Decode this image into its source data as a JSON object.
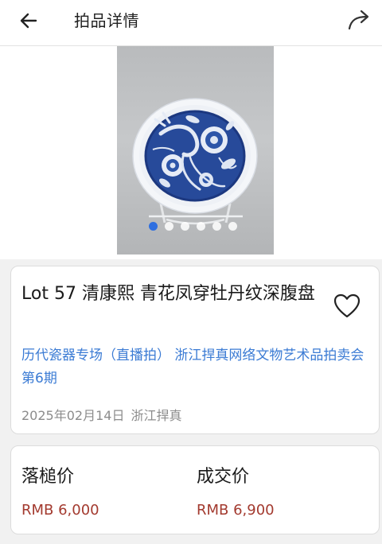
{
  "header": {
    "title": "拍品详情",
    "back_icon": "arrow-left-icon",
    "share_icon": "share-arrow-icon"
  },
  "gallery": {
    "image_count": 6,
    "active_index": 0
  },
  "lot": {
    "title": "Lot 57 清康熙 青花凤穿牡丹纹深腹盘",
    "favorite_icon": "heart-outline-icon",
    "session": "历代瓷器专场（直播拍） 浙江捍真网络文物艺术品拍卖会第6期",
    "date": "2025年02月14日",
    "auction_house": "浙江捍真"
  },
  "prices": {
    "hammer_label": "落槌价",
    "hammer_value": "RMB 6,000",
    "deal_label": "成交价",
    "deal_value": "RMB 6,900"
  },
  "colors": {
    "link": "#3b7bd4",
    "price": "#a33a2f",
    "active_dot": "#2f6fe0"
  }
}
